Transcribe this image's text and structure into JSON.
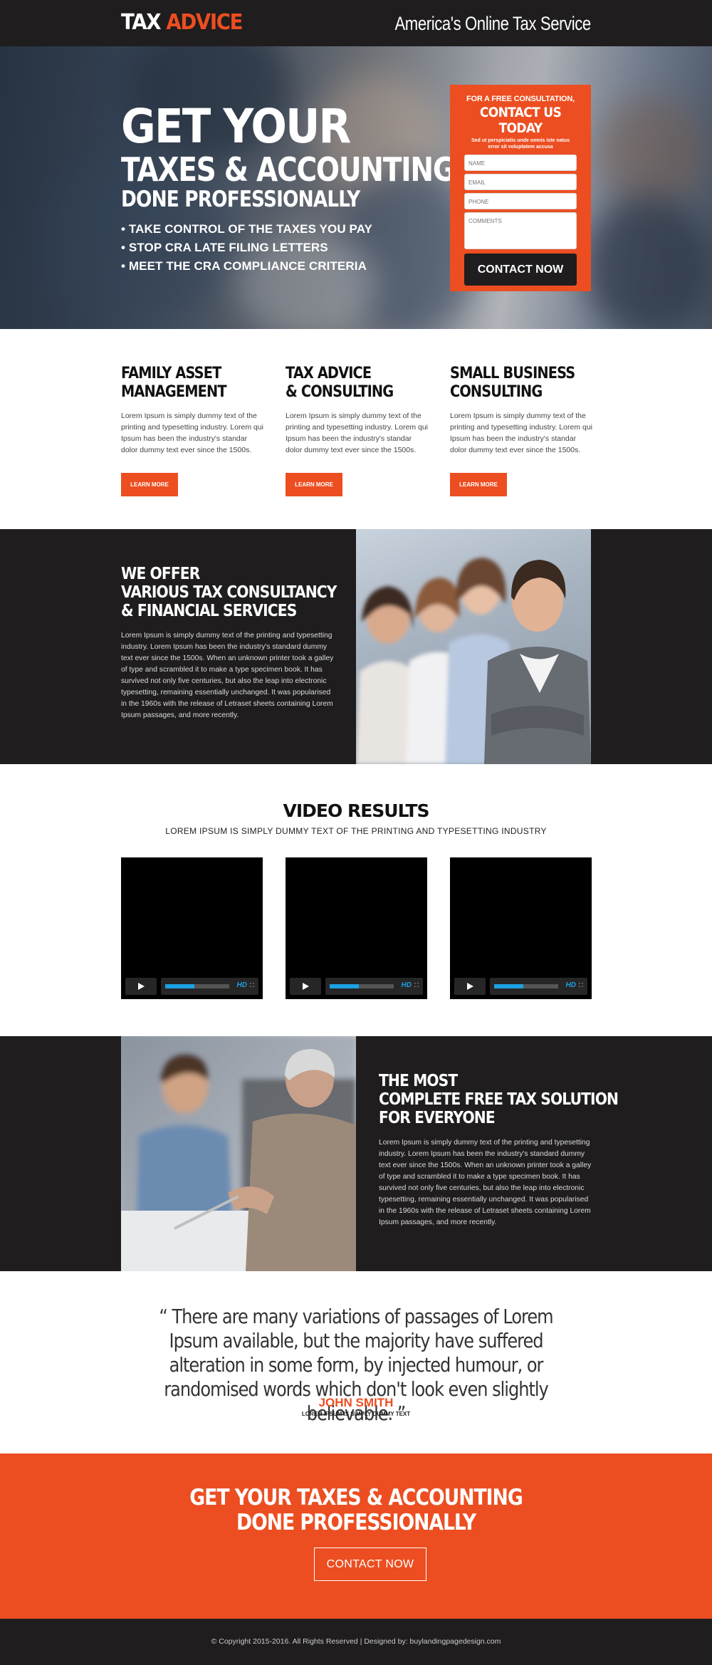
{
  "header": {
    "logo_main": "TAX ",
    "logo_accent": "ADVICE",
    "tagline": "America's Online Tax Service"
  },
  "hero": {
    "line1": "GET YOUR",
    "line2": "TAXES & ACCOUNTING",
    "line3": "DONE PROFESSIONALLY",
    "bullets": [
      "• TAKE CONTROL OF THE TAXES YOU PAY",
      "• STOP CRA LATE FILING LETTERS",
      "• MEET THE CRA COMPLIANCE CRITERIA"
    ]
  },
  "form": {
    "kicker": "FOR A FREE CONSULTATION,",
    "title": "CONTACT US TODAY",
    "subtitle": "Sed ut perspiciatis unde omnis iste natus error sit voluptatem accusa",
    "name_placeholder": "NAME",
    "email_placeholder": "EMAIL",
    "phone_placeholder": "PHONE",
    "comments_placeholder": "COMMENTS",
    "submit_label": "CONTACT NOW"
  },
  "features": [
    {
      "title1": "FAMILY ASSET",
      "title2": "MANAGEMENT",
      "text": "Lorem Ipsum is simply dummy text of the printing and typesetting industry. Lorem qui Ipsum has been the industry's standar dolor dummy text ever since the 1500s.",
      "button": "LEARN MORE"
    },
    {
      "title1": "TAX ADVICE",
      "title2": "& CONSULTING",
      "text": "Lorem Ipsum is simply dummy text of the printing and typesetting industry. Lorem qui Ipsum has been the industry's standar dolor dummy text ever since the 1500s.",
      "button": "LEARN MORE"
    },
    {
      "title1": "SMALL BUSINESS",
      "title2": "CONSULTING",
      "text": "Lorem Ipsum is simply dummy text of the printing and typesetting industry. Lorem qui Ipsum has been the industry's standar dolor dummy text ever since the 1500s.",
      "button": "LEARN MORE"
    }
  ],
  "offer": {
    "line1": "WE OFFER",
    "line2": "VARIOUS TAX CONSULTANCY",
    "line3": "& FINANCIAL SERVICES",
    "text": "Lorem Ipsum is simply dummy text of the printing and typesetting industry. Lorem Ipsum has been the industry's standard dummy text ever since the 1500s. When an unknown printer took a galley of type and scrambled it to make a type specimen book. It has survived not only five centuries, but also the leap into electronic typesetting, remaining essentially unchanged. It was popularised in the 1960s with the release of Letraset sheets containing Lorem Ipsum passages, and more recently."
  },
  "video": {
    "title": "VIDEO RESULTS",
    "subtitle": "LOREM IPSUM IS SIMPLY DUMMY TEXT OF THE PRINTING AND TYPESETTING INDUSTRY",
    "hd_label": "HD",
    "progress": 0.45
  },
  "solution": {
    "line1": "THE MOST",
    "line2": "COMPLETE FREE TAX SOLUTION",
    "line3": "FOR EVERYONE",
    "text": "Lorem Ipsum is simply dummy text of the printing and typesetting industry. Lorem Ipsum has been the industry's standard dummy text ever since the 1500s. When an unknown printer took a galley of type and scrambled it to make a type specimen book. It has survived not only five centuries, but also the leap into electronic typesetting, remaining essentially unchanged. It was popularised in the 1960s with the release of Letraset sheets containing Lorem Ipsum passages, and more recently."
  },
  "testimonial": {
    "quote": "“ There are many variations of passages of Lorem Ipsum available, but the majority have suffered alteration in some form, by injected humour, or randomised words which don't look even slightly believable. ”",
    "name": "JOHN SMITH",
    "role": "LOREM IPSUM IS SIMPLY DUMMY TEXT"
  },
  "cta": {
    "line1": "GET YOUR TAXES & ACCOUNTING",
    "line2": "DONE PROFESSIONALLY",
    "button": "CONTACT NOW"
  },
  "footer": {
    "text": "© Copyright 2015-2016. All Rights Reserved  |  Designed by: buylandingpagedesign.com"
  },
  "colors": {
    "accent": "#ec4e21",
    "dark": "#1f1d1e",
    "video_accent": "#1ba1e2"
  }
}
